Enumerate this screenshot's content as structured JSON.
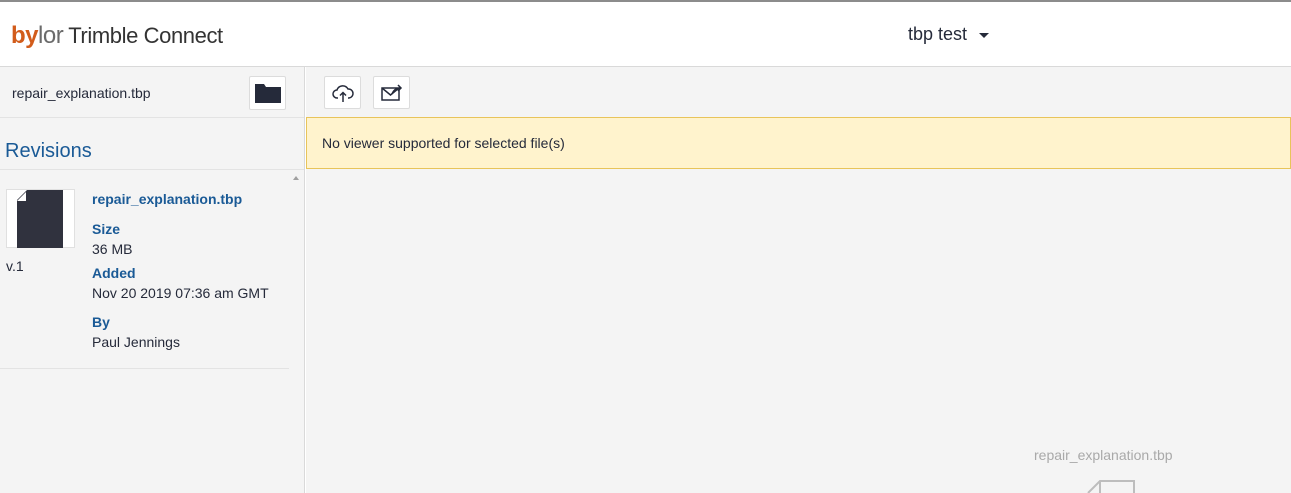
{
  "header": {
    "logo_by": "by",
    "logo_lor": "lor",
    "logo_product": "Trimble Connect",
    "project_name": "tbp test"
  },
  "left_panel": {
    "file_name": "repair_explanation.tbp",
    "revisions_title": "Revisions",
    "revision": {
      "version": "v.1",
      "file_name": "repair_explanation.tbp",
      "size_label": "Size",
      "size_value": "36 MB",
      "added_label": "Added",
      "added_value": "Nov 20 2019 07:36 am GMT",
      "by_label": "By",
      "by_value": "Paul Jennings"
    }
  },
  "main": {
    "notice": "No viewer supported for selected file(s)",
    "viewer_file_name": "repair_explanation.tbp"
  },
  "icons": {
    "folder": "folder-icon",
    "upload": "cloud-upload-icon",
    "share": "share-icon",
    "file": "file-icon"
  },
  "colors": {
    "brand_orange": "#d25c1b",
    "link_blue": "#1a5a96",
    "notice_bg": "#fff3cd",
    "notice_border": "#e8c45a",
    "dark_icon": "#30323e"
  }
}
